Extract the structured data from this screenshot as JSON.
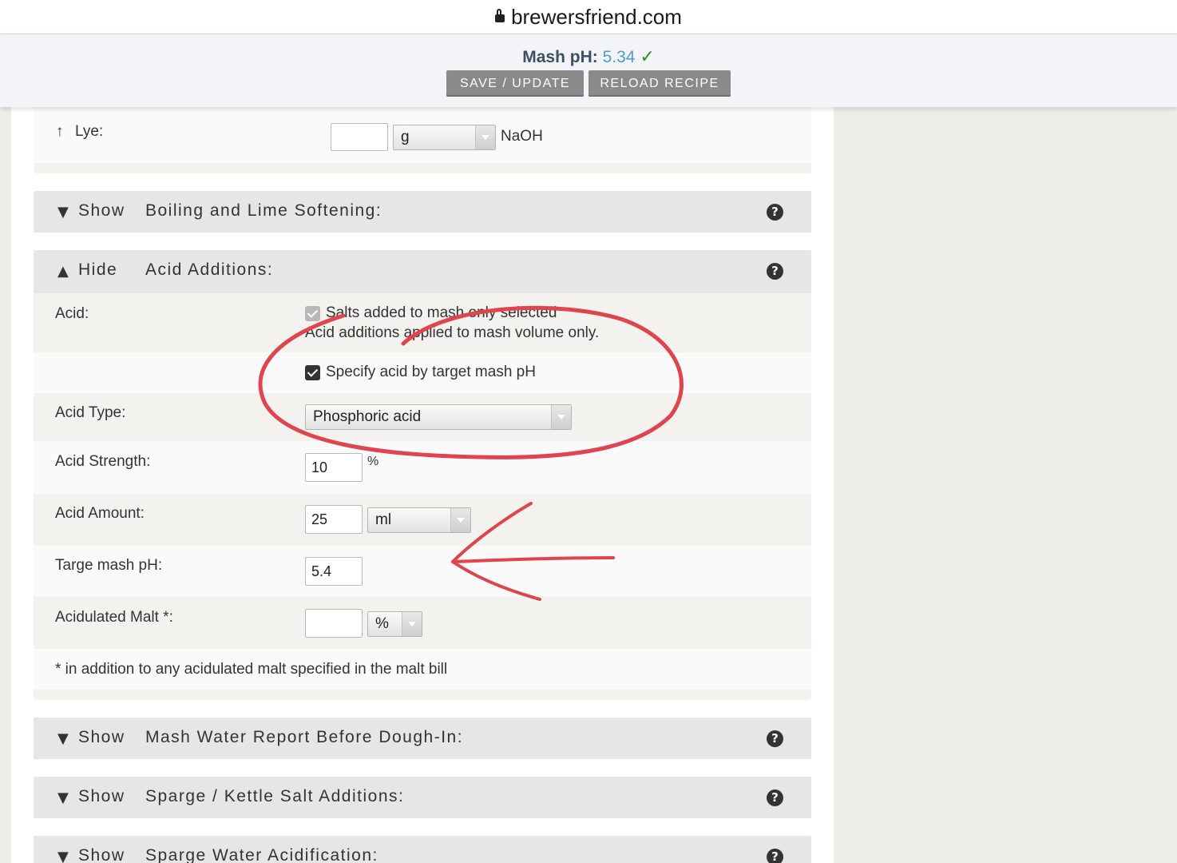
{
  "browser": {
    "domain": "brewersfriend.com"
  },
  "status": {
    "mash_ph_label": "Mash pH:",
    "mash_ph_value": "5.34",
    "check": "✓"
  },
  "buttons": {
    "save": "SAVE / UPDATE",
    "reload": "RELOAD RECIPE"
  },
  "lye": {
    "arrow": "↑",
    "label": "Lye:",
    "value": "",
    "unit": "g",
    "suffix": "NaOH"
  },
  "sections": {
    "boiling": {
      "toggle": "Show",
      "title": "Boiling and Lime Softening:"
    },
    "acid": {
      "toggle": "Hide",
      "title": "Acid Additions:"
    },
    "mash_report": {
      "toggle": "Show",
      "title": "Mash Water Report Before Dough-In:"
    },
    "sparge_salt": {
      "toggle": "Show",
      "title": "Sparge / Kettle Salt Additions:"
    },
    "sparge_acid": {
      "toggle": "Show",
      "title": "Sparge Water Acidification:"
    }
  },
  "acid": {
    "acid_label": "Acid:",
    "salts_line1": "Salts added to mash only selected",
    "salts_line2": "Acid additions applied to mash volume only.",
    "specify_label": "Specify acid by target mash pH",
    "type_label": "Acid Type:",
    "type_value": "Phosphoric acid",
    "strength_label": "Acid Strength:",
    "strength_value": "10",
    "strength_unit": "%",
    "amount_label": "Acid Amount:",
    "amount_value": "25",
    "amount_unit": "ml",
    "target_label": "Targe mash pH:",
    "target_value": "5.4",
    "acid_malt_label": "Acidulated Malt *:",
    "acid_malt_value": "",
    "acid_malt_unit": "%",
    "footnote": "* in addition to any acidulated malt specified in the malt bill"
  },
  "icons": {
    "help": "question-circle-icon",
    "lock": "lock-icon",
    "triangle_down": "triangle-down-icon",
    "triangle_up": "triangle-up-icon"
  },
  "colors": {
    "accent_blue": "#4d9bd6",
    "check_green": "#2e8b2e",
    "annotation_red": "#e0444f",
    "button_gray": "#8a8a8a"
  }
}
